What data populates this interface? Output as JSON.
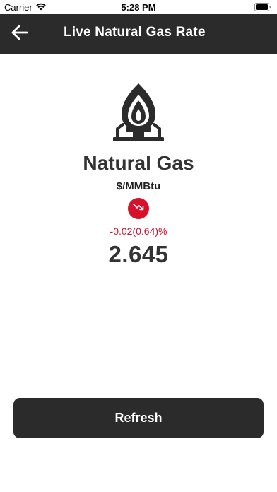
{
  "status_bar": {
    "carrier": "Carrier",
    "time": "5:28 PM",
    "icons": [
      "wifi-icon",
      "battery-icon"
    ]
  },
  "nav": {
    "title": "Live Natural Gas Rate",
    "back_icon": "arrow-left-icon"
  },
  "main": {
    "icon": "gas-burner-icon",
    "commodity": "Natural Gas",
    "unit": "$/MMBtu",
    "trend_icon": "trend-down-icon",
    "change": "-0.02(0.64)%",
    "price": "2.645"
  },
  "actions": {
    "refresh_label": "Refresh"
  },
  "colors": {
    "nav_background": "#2b2b2b",
    "trend_down": "#d8102a",
    "text_primary": "#333333"
  }
}
